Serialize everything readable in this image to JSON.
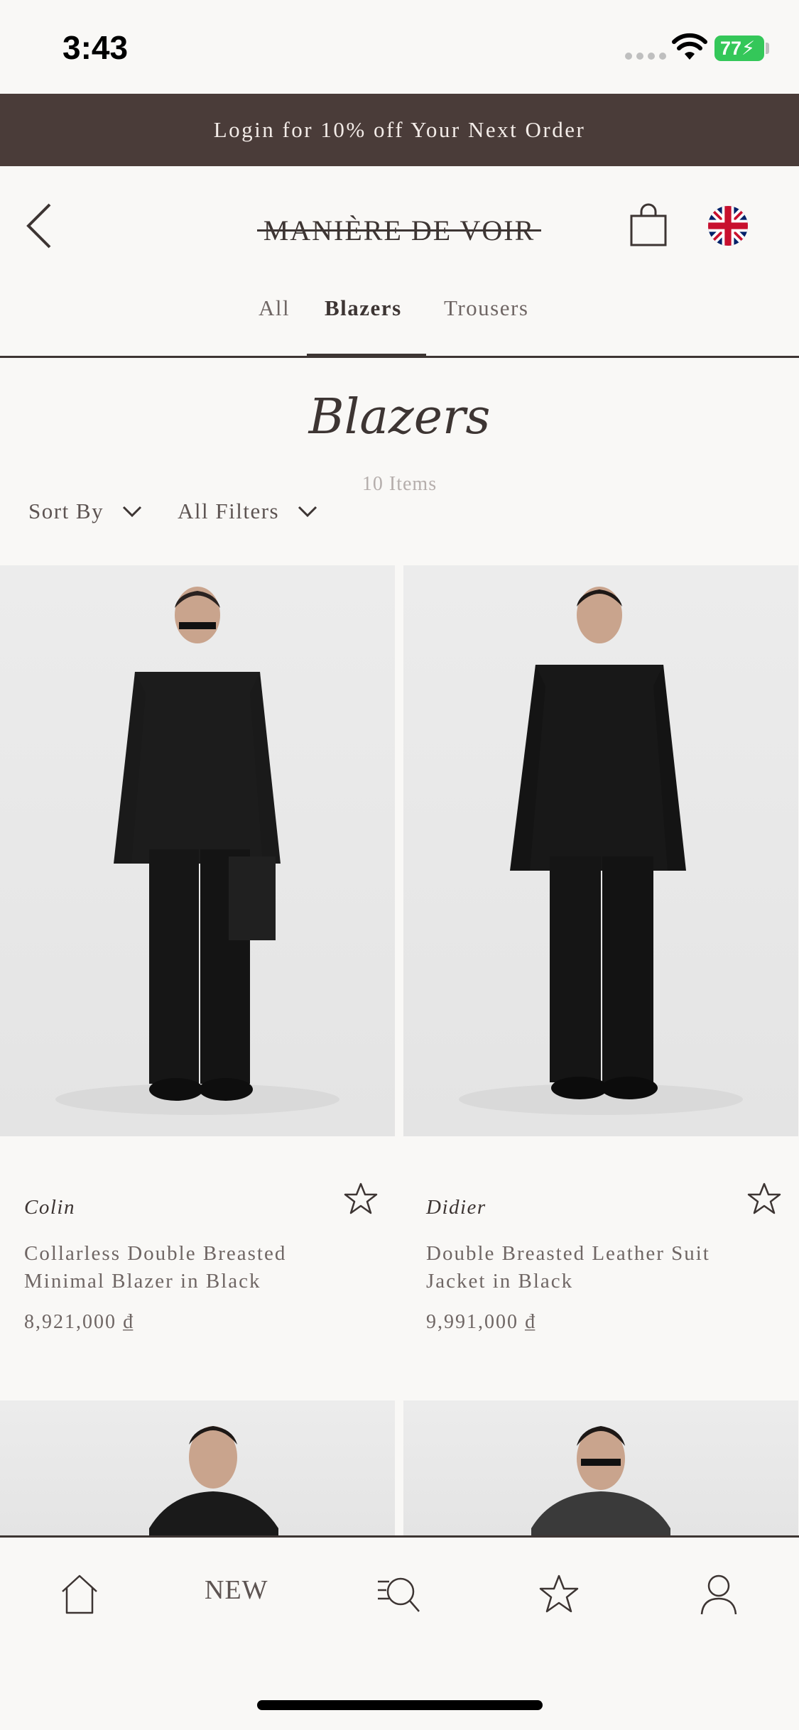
{
  "status_bar": {
    "time": "3:43",
    "battery": "77"
  },
  "promo_banner": {
    "text": "Login for 10% off Your Next Order"
  },
  "header": {
    "brand": "MANIÈRE DE VOIR",
    "back_icon": "chevron-left-icon",
    "bag_icon": "shopping-bag-icon",
    "flag_icon": "uk-flag-icon"
  },
  "tabs": [
    {
      "label": "All",
      "active": false
    },
    {
      "label": "Blazers",
      "active": true
    },
    {
      "label": "Trousers",
      "active": false
    }
  ],
  "listing": {
    "title": "Blazers",
    "count": "10 Items",
    "sort_label": "Sort By",
    "filter_label": "All Filters"
  },
  "products": [
    {
      "brand": "Colin",
      "name": "Collarless Double Breasted Minimal Blazer in Black",
      "price": "8,921,000 ₫"
    },
    {
      "brand": "Didier",
      "name": "Double Breasted Leather Suit Jacket in Black",
      "price": "9,991,000 ₫"
    }
  ],
  "bottom_nav": {
    "home_icon": "home-icon",
    "new_label": "NEW",
    "search_icon": "search-icon",
    "wishlist_icon": "star-icon",
    "account_icon": "user-icon"
  },
  "colors": {
    "banner_bg": "#4a3c39",
    "text": "#3d3533",
    "muted": "#6f6664",
    "battery": "#34c759",
    "background": "#f9f8f6"
  }
}
